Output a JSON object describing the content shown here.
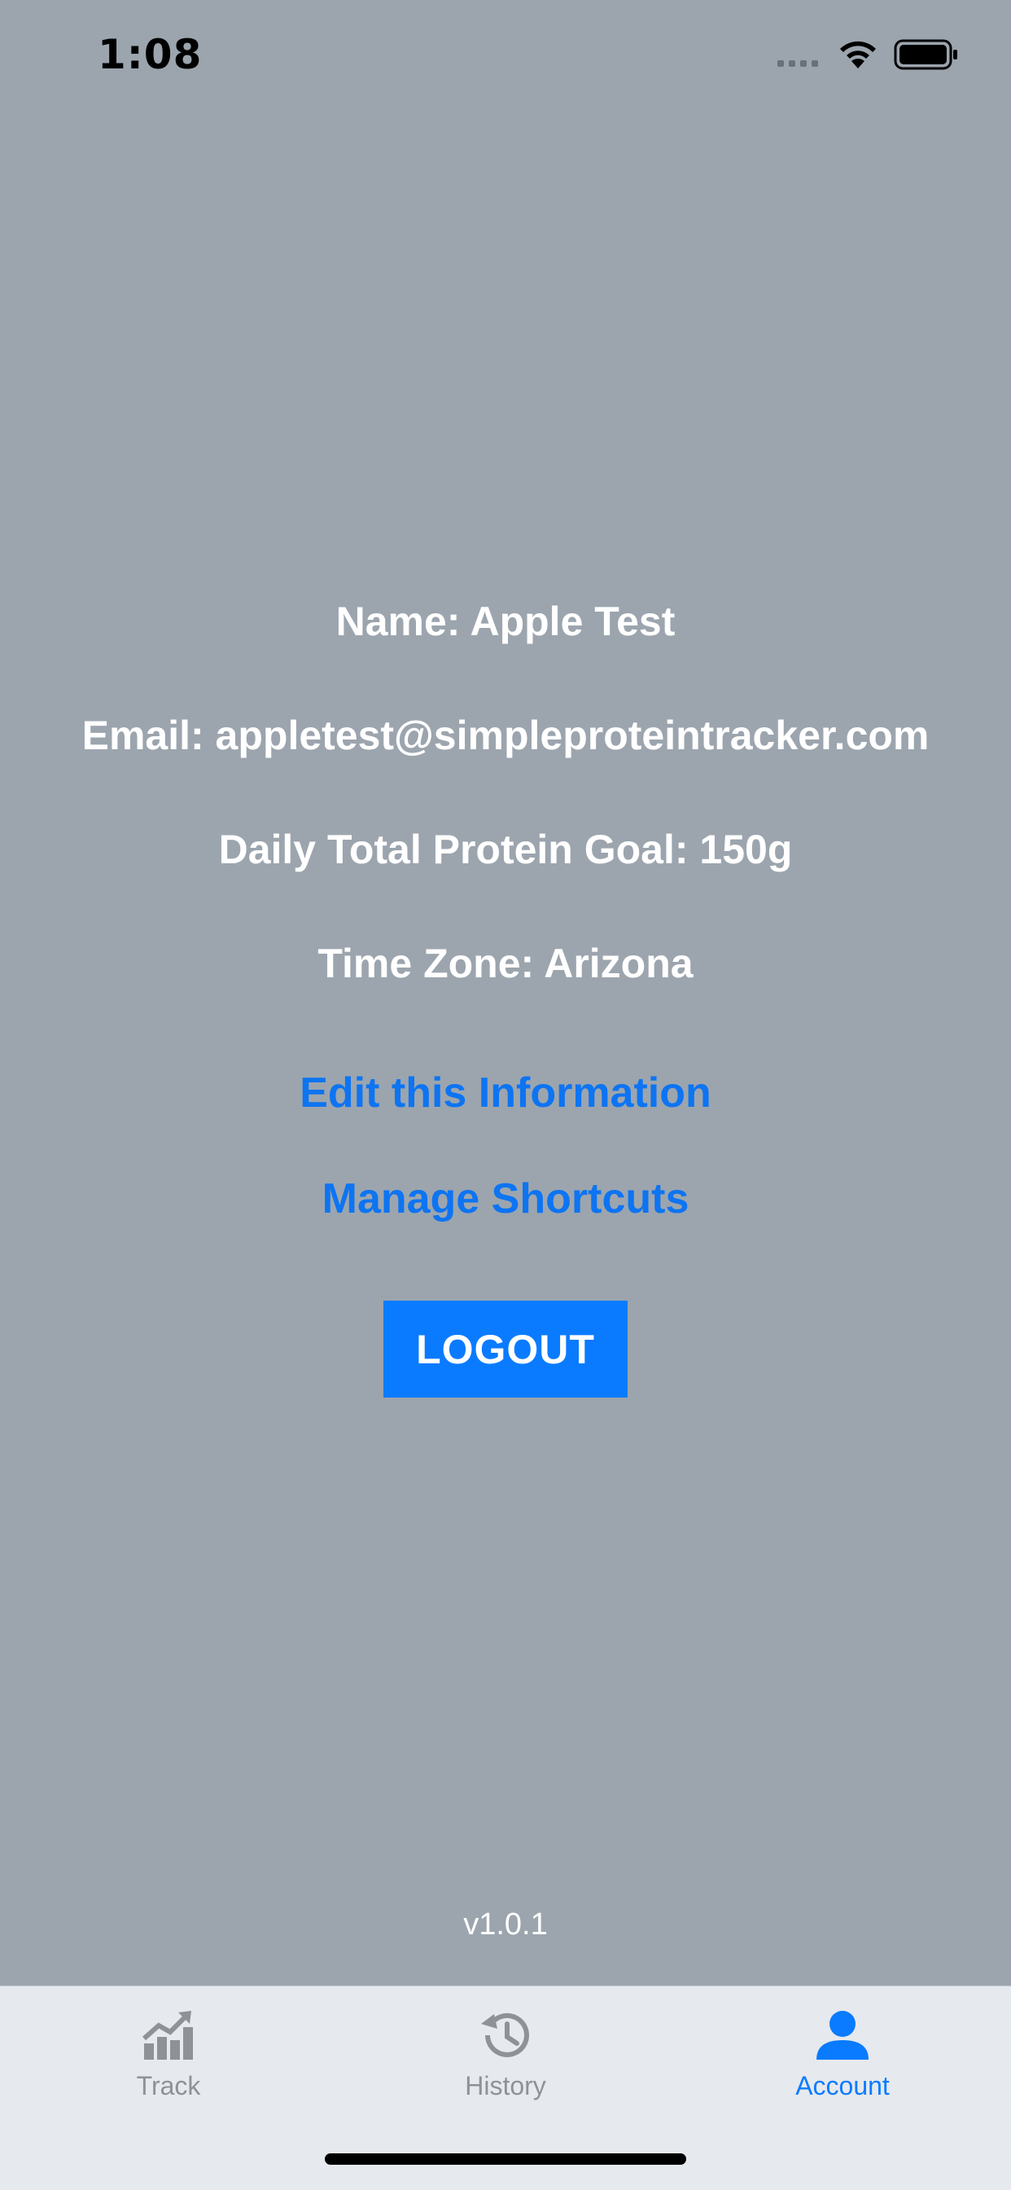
{
  "status_bar": {
    "time": "1:08"
  },
  "account": {
    "name_line": "Name: Apple Test",
    "email_line": "Email: appletest@simpleproteintracker.com",
    "goal_line": "Daily Total Protein Goal: 150g",
    "timezone_line": "Time Zone: Arizona"
  },
  "actions": {
    "edit_label": "Edit this Information",
    "shortcuts_label": "Manage Shortcuts",
    "logout_label": "LOGOUT"
  },
  "version": "v1.0.1",
  "tab_bar": {
    "tabs": [
      {
        "label": "Track",
        "icon": "chart-icon",
        "active": false
      },
      {
        "label": "History",
        "icon": "history-icon",
        "active": false
      },
      {
        "label": "Account",
        "icon": "person-icon",
        "active": true
      }
    ]
  },
  "colors": {
    "background": "#9ca5ae",
    "accent": "#0a7bff",
    "link": "#0d74f2",
    "tab_inactive": "#8e9297",
    "tab_bar_bg": "#e6e9ed"
  }
}
